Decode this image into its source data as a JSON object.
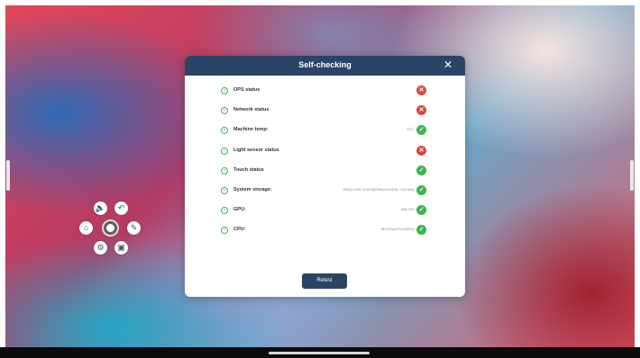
{
  "dialog": {
    "title": "Self-checking",
    "close_symbol": "✕",
    "retest_label": "Retest",
    "items": [
      {
        "label": "OPS status",
        "value": "",
        "status": "fail"
      },
      {
        "label": "Network status",
        "value": "",
        "status": "fail"
      },
      {
        "label": "Machine temp:",
        "value": "43°C",
        "status": "ok"
      },
      {
        "label": "Light sensor status",
        "value": "",
        "status": "fail"
      },
      {
        "label": "Touch status",
        "value": "",
        "status": "ok"
      },
      {
        "label": "System storage:",
        "value": "RAM(3.1208 / 8.00GB)ROM(113.84GB / 128.0GB)",
        "status": "ok"
      },
      {
        "label": "GPU:",
        "value": "Mali-G52",
        "status": "ok"
      },
      {
        "label": "CPU:",
        "value": "RK3576(A72*4+A55*4)",
        "status": "ok"
      }
    ],
    "status_symbols": {
      "ok": "✓",
      "fail": "✕"
    },
    "colors": {
      "header": "#2b4466",
      "ok": "#3bb54a",
      "fail": "#e0473f"
    }
  },
  "floating_menu": {
    "icons": [
      "volume-icon",
      "back-icon",
      "home-icon",
      "screenshot-icon",
      "settings-icon",
      "annotate-icon"
    ],
    "glyphs": {
      "volume": "🔈",
      "back": "↶",
      "home": "⌂",
      "screenshot": "▣",
      "settings": "⚙",
      "annotate": "✎"
    }
  }
}
